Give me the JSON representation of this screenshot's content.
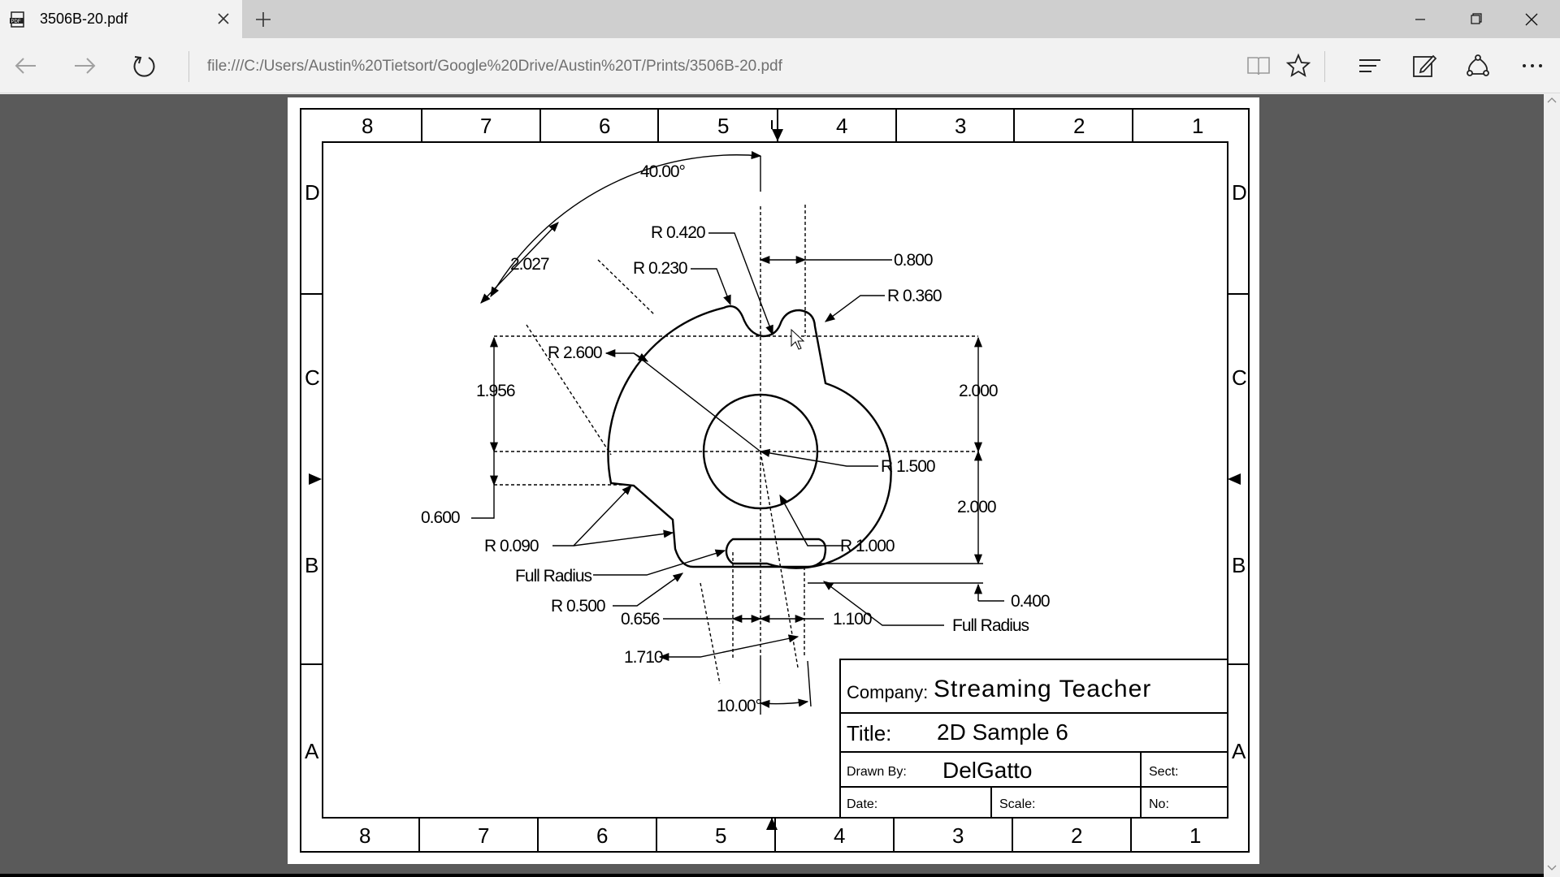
{
  "tab": {
    "title": "3506B-20.pdf",
    "icon": "pdf-icon"
  },
  "address": {
    "url": "file:///C:/Users/Austin%20Tietsort/Google%20Drive/Austin%20T/Prints/3506B-20.pdf"
  },
  "drawing": {
    "zones_top": [
      "8",
      "7",
      "6",
      "5",
      "4",
      "3",
      "2",
      "1"
    ],
    "zones_side": [
      "D",
      "C",
      "B",
      "A"
    ],
    "dimensions": {
      "angle_40": "40.00°",
      "d2027": "2.027",
      "r0420": "R 0.420",
      "r0230": "R 0.230",
      "d0800": "0.800",
      "r0360": "R 0.360",
      "r2600": "R 2.600",
      "d1956": "1.956",
      "d2000a": "2.000",
      "r1500": "R 1.500",
      "d2000b": "2.000",
      "d0600": "0.600",
      "r1000": "R 1.000",
      "r0090": "R 0.090",
      "full_radius_1": "Full Radius",
      "r0500": "R 0.500",
      "d0400": "0.400",
      "d0656": "0.656",
      "d1100": "1.100",
      "full_radius_2": "Full Radius",
      "d1710": "1.710",
      "angle_10": "10.00°"
    },
    "title_block": {
      "company_label": "Company:",
      "company_value": "Streaming Teacher",
      "title_label": "Title:",
      "title_value": "2D Sample 6",
      "drawn_by_label": "Drawn By:",
      "drawn_by_value": "DelGatto",
      "sect_label": "Sect:",
      "date_label": "Date:",
      "scale_label": "Scale:",
      "no_label": "No:"
    }
  }
}
